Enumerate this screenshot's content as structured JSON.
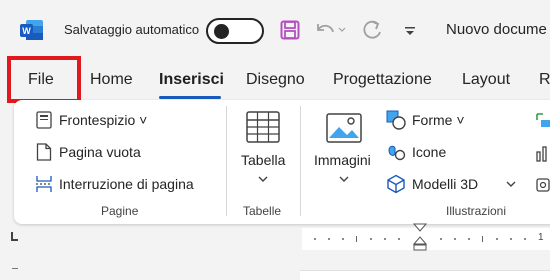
{
  "titlebar": {
    "autosave_label": "Salvataggio automatico",
    "document_title": "Nuovo docume"
  },
  "tabs": [
    "File",
    "Home",
    "Inserisci",
    "Disegno",
    "Progettazione",
    "Layout",
    "R"
  ],
  "active_tab": "Inserisci",
  "ribbon": {
    "pagine": {
      "items": [
        "Frontespizio",
        "Pagina vuota",
        "Interruzione di pagina"
      ],
      "label": "Pagine"
    },
    "tabelle": {
      "button": "Tabella",
      "label": "Tabelle"
    },
    "illustrazioni": {
      "images_button": "Immagini",
      "items": [
        "Forme",
        "Icone",
        "Modelli 3D"
      ],
      "label": "Illustrazioni"
    }
  },
  "ruler": {
    "number": "1"
  },
  "colors": {
    "accent": "#185abd",
    "highlight": "#e0191f",
    "word_blue": "#185abd",
    "save_purple": "#b44fc2"
  }
}
